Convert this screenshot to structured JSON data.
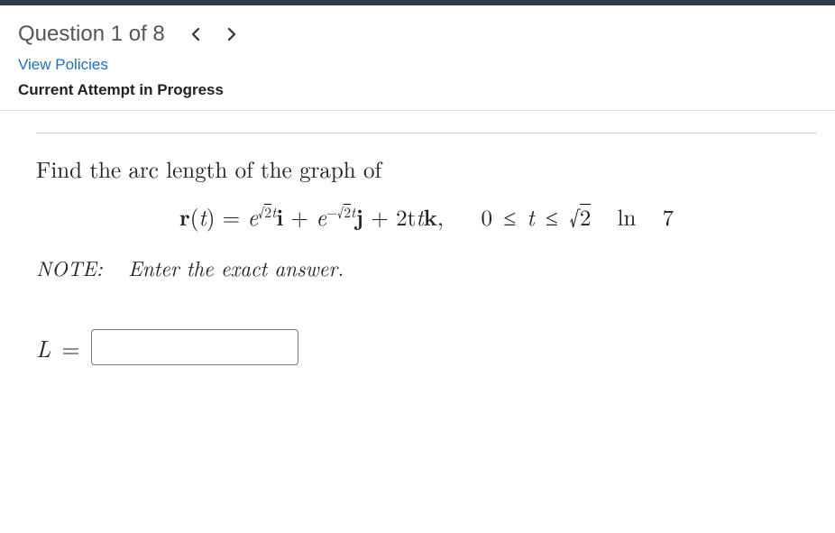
{
  "header": {
    "question_label": "Question 1 of 8"
  },
  "links": {
    "view_policies": "View Policies"
  },
  "status": {
    "attempt": "Current Attempt in Progress"
  },
  "problem": {
    "prompt": "Find the arc length of the graph of",
    "note_label": "NOTE:",
    "note_text": "Enter the exact answer.",
    "answer_var": "L",
    "equals": "=",
    "equation": {
      "r": "r",
      "t": "t",
      "e": "e",
      "two": "2",
      "i": "i",
      "j": "j",
      "k": "k",
      "plus": "+",
      "minus": "−",
      "twot": "2t",
      "sqrt2t": "2t",
      "comma": ",",
      "zero": "0",
      "le": "≤",
      "tvar": "t",
      "sqrt2": "2",
      "ln": "ln",
      "seven": "7"
    }
  },
  "icons": {
    "prev": "chevron-left-icon",
    "next": "chevron-right-icon"
  }
}
